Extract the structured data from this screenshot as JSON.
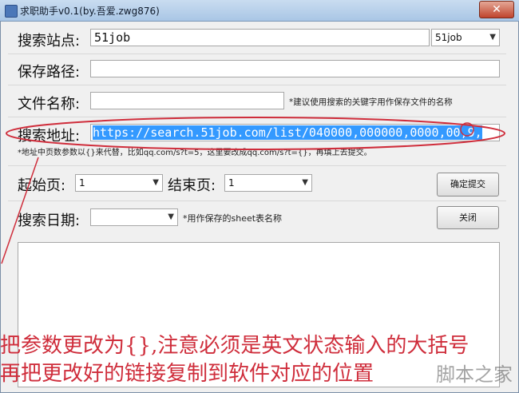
{
  "window": {
    "title": "求职助手v0.1(by.吾爱.zwg876)",
    "close_label": "✕"
  },
  "form": {
    "site_label": "搜索站点:",
    "site_value": "51job",
    "site_dropdown_value": "51job",
    "save_path_label": "保存路径:",
    "save_path_value": "",
    "filename_label": "文件名称:",
    "filename_value": "",
    "filename_hint": "*建议使用搜索的关键字用作保存文件的名称",
    "search_url_label": "搜索地址:",
    "search_url_value": "https://search.51job.com/list/040000,000000,0000,00,9,",
    "search_url_hint": "*地址中页数参数以{}来代替，比如qq.com/s?t=5，这里要改成qq.com/s?t={}，再填上去提交。",
    "start_page_label": "起始页:",
    "start_page_value": "1",
    "end_page_label": "结束页:",
    "end_page_value": "1",
    "confirm_label": "确定提交",
    "search_date_label": "搜索日期:",
    "search_date_value": "",
    "search_date_hint": "*用作保存的sheet表名称",
    "close_button_label": "关闭"
  },
  "annotation": {
    "line1": "把参数更改为{},注意必须是英文状态输入的大括号",
    "line2": "再把更改好的链接复制到软件对应的位置"
  },
  "watermark": {
    "text": "脚本之家"
  },
  "colors": {
    "annotation": "#cf2d3b",
    "selection": "#3399ff"
  }
}
